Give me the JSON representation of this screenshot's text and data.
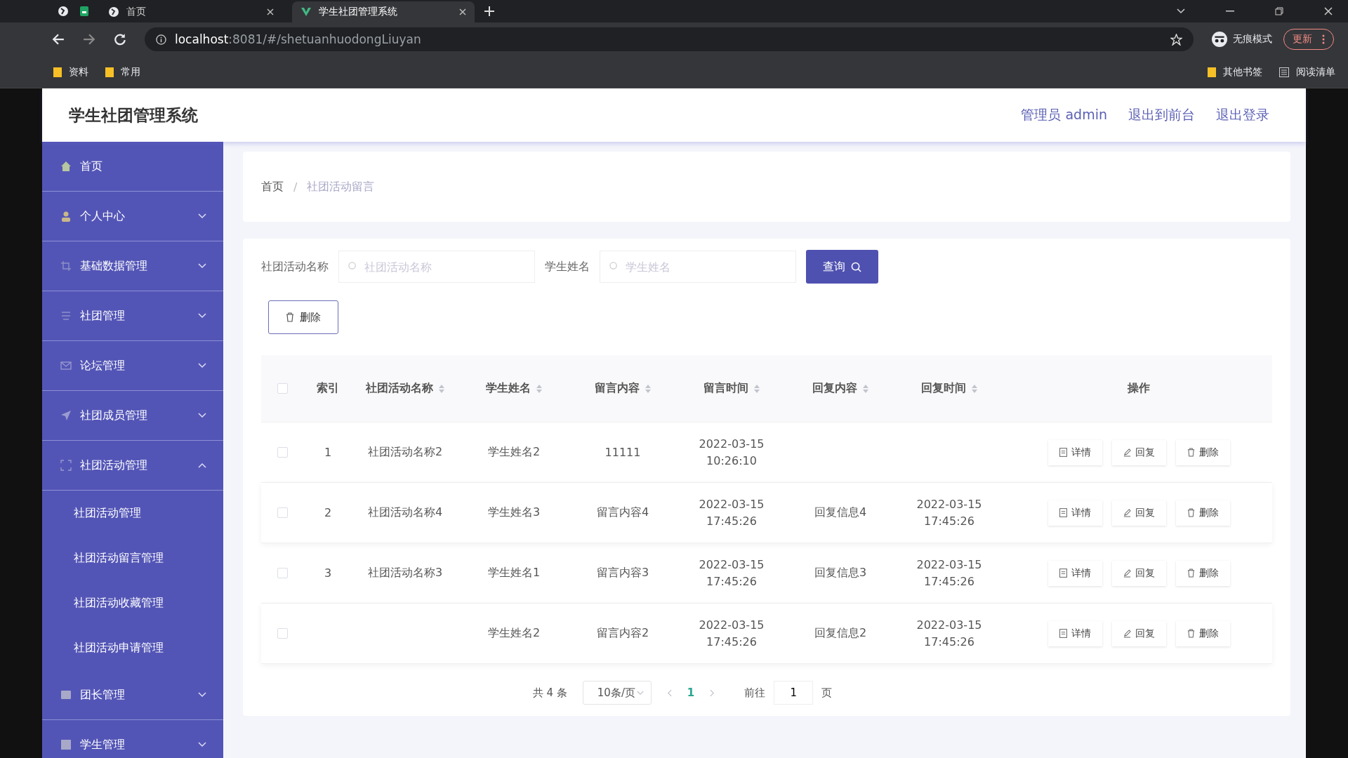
{
  "browser": {
    "tabs": [
      {
        "title": "首页",
        "selected": false
      },
      {
        "title": "学生社团管理系统",
        "selected": true
      }
    ],
    "url_host": "localhost",
    "url_path": ":8081/#/shetuanhuodongLiuyan",
    "incognito": "无痕模式",
    "update": "更新",
    "bookmarks_left": [
      "资料",
      "常用"
    ],
    "bookmarks_right": [
      "其他书签",
      "阅读清单"
    ]
  },
  "header": {
    "title": "学生社团管理系统",
    "links": [
      "管理员 admin",
      "退出到前台",
      "退出登录"
    ]
  },
  "sidebar": {
    "items": [
      {
        "label": "首页",
        "kind": "link"
      },
      {
        "label": "个人中心",
        "kind": "menu",
        "expanded": false
      },
      {
        "label": "基础数据管理",
        "kind": "menu",
        "expanded": false
      },
      {
        "label": "社团管理",
        "kind": "menu",
        "expanded": false
      },
      {
        "label": "论坛管理",
        "kind": "menu",
        "expanded": false
      },
      {
        "label": "社团成员管理",
        "kind": "menu",
        "expanded": false
      },
      {
        "label": "社团活动管理",
        "kind": "menu",
        "expanded": true,
        "children": [
          {
            "label": "社团活动管理"
          },
          {
            "label": "社团活动留言管理"
          },
          {
            "label": "社团活动收藏管理"
          },
          {
            "label": "社团活动申请管理"
          }
        ]
      },
      {
        "label": "团长管理",
        "kind": "menu",
        "expanded": false
      },
      {
        "label": "学生管理",
        "kind": "menu",
        "expanded": false
      }
    ]
  },
  "breadcrumb": [
    "首页",
    "社团活动留言"
  ],
  "breadcrumb_separator": "/",
  "filters": [
    {
      "label": "社团活动名称",
      "placeholder": "社团活动名称"
    },
    {
      "label": "学生姓名",
      "placeholder": "学生姓名"
    }
  ],
  "search_button": "查询",
  "delete_button": "删除",
  "table": {
    "columns": [
      {
        "label": "索引",
        "sortable": false
      },
      {
        "label": "社团活动名称",
        "sortable": true
      },
      {
        "label": "学生姓名",
        "sortable": true
      },
      {
        "label": "留言内容",
        "sortable": true
      },
      {
        "label": "留言时间",
        "sortable": true
      },
      {
        "label": "回复内容",
        "sortable": true
      },
      {
        "label": "回复时间",
        "sortable": true
      },
      {
        "label": "操作",
        "sortable": false
      }
    ],
    "header_checked": false,
    "rows": [
      {
        "checked": false,
        "index": "1",
        "activity": "社团活动名称2",
        "student": "学生姓名2",
        "content": "11111",
        "time": "2022-03-15 10:26:10",
        "actions": [
          "详情",
          "回复",
          "删除"
        ]
      },
      {
        "checked": false,
        "index": "2",
        "activity": "社团活动名称4",
        "student": "学生姓名3",
        "content": "留言内容4",
        "time": "2022-03-15 17:45:26",
        "reply": "回复信息4",
        "reply_time": "2022-03-15 17:45:26",
        "actions": [
          "详情",
          "回复",
          "删除"
        ]
      },
      {
        "checked": false,
        "index": "3",
        "activity": "社团活动名称3",
        "student": "学生姓名1",
        "content": "留言内容3",
        "time": "2022-03-15 17:45:26",
        "reply": "回复信息3",
        "reply_time": "2022-03-15 17:45:26",
        "actions": [
          "详情",
          "回复",
          "删除"
        ]
      },
      {
        "checked": false,
        "student": "学生姓名2",
        "content": "留言内容2",
        "time": "2022-03-15 17:45:26",
        "reply": "回复信息2",
        "reply_time": "2022-03-15 17:45:26",
        "actions": [
          "详情",
          "回复",
          "删除"
        ]
      }
    ]
  },
  "pagination": {
    "total": "共 4 条",
    "page_size": "10条/页",
    "pages": [
      {
        "label": "1",
        "selected": true
      }
    ],
    "goto": "前往",
    "goto_value": "1",
    "goto_suffix": "页"
  }
}
